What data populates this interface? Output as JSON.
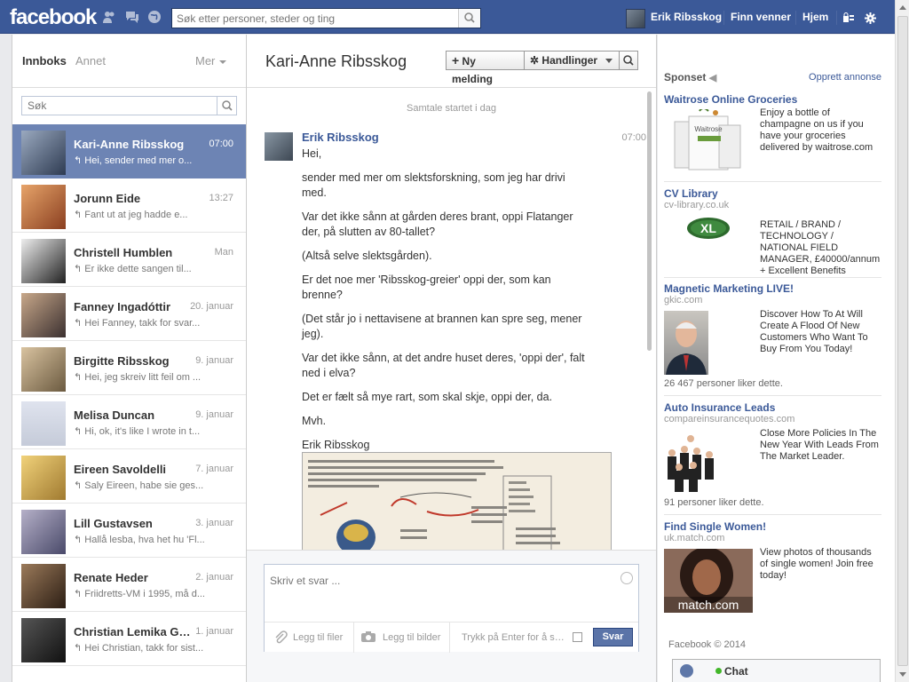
{
  "topbar": {
    "logo": "facebook",
    "search_placeholder": "Søk etter personer, steder og ting",
    "user_name": "Erik Ribsskog",
    "find_friends": "Finn venner",
    "home": "Hjem"
  },
  "left": {
    "tab_inbox": "Innboks",
    "tab_other": "Annet",
    "more": "Mer",
    "search_placeholder": "Søk",
    "threads": [
      {
        "name": "Kari-Anne Ribsskog",
        "date": "07:00",
        "snippet": "Hei, sender med mer o...",
        "selected": true
      },
      {
        "name": "Jorunn Eide",
        "date": "13:27",
        "snippet": "Fant ut at jeg hadde e..."
      },
      {
        "name": "Christell Humblen",
        "date": "Man",
        "snippet": "Er ikke dette sangen til..."
      },
      {
        "name": "Fanney Ingadóttir",
        "date": "20. januar",
        "snippet": "Hei Fanney, takk for svar..."
      },
      {
        "name": "Birgitte Ribsskog",
        "date": "9. januar",
        "snippet": "Hei, jeg skreiv litt feil om ..."
      },
      {
        "name": "Melisa Duncan",
        "date": "9. januar",
        "snippet": "Hi, ok, it's like I wrote in t..."
      },
      {
        "name": "Eireen Savoldelli",
        "date": "7. januar",
        "snippet": "Saly Eireen, habe sie ges..."
      },
      {
        "name": "Lill Gustavsen",
        "date": "3. januar",
        "snippet": "Hallå lesba, hva het hu 'Fl..."
      },
      {
        "name": "Renate Heder",
        "date": "2. januar",
        "snippet": "Friidretts-VM i 1995, må d..."
      },
      {
        "name": "Christian Lemika Gr...",
        "date": "1. januar",
        "snippet": "Hei Christian, takk for sist..."
      }
    ]
  },
  "conversation": {
    "title": "Kari-Anne Ribsskog",
    "new_message": "Ny melding",
    "actions": "Handlinger",
    "started": "Samtale startet i dag",
    "author": "Erik Ribsskog",
    "time": "07:00",
    "lines": [
      "Hei,",
      "sender med mer om slektsforskning, som jeg har drivi med.",
      "Var det ikke sånn at gården deres brant, oppi Flatanger der, på slutten av 80-tallet?",
      "(Altså selve slektsgården).",
      "Er det noe mer 'Ribsskog-greier' oppi der, som kan brenne?",
      "(Det står jo i nettavisene at brannen kan spre seg, mener jeg).",
      "Var det ikke sånn, at det andre huset deres, 'oppi der', falt ned i elva?",
      "Det er fælt så mye rart, som skal skje, oppi der, da.",
      "Mvh.",
      "Erik Ribsskog"
    ],
    "reply_placeholder": "Skriv et svar ...",
    "add_files": "Legg til filer",
    "add_photos": "Legg til bilder",
    "enter_to_send": "Trykk på Enter for å se...",
    "reply_button": "Svar"
  },
  "ads": {
    "sponsored": "Sponset",
    "create_ad": "Opprett annonse",
    "items": [
      {
        "title": "Waitrose Online Groceries",
        "url": "",
        "body": "Enjoy a bottle of champagne on us if you have your groceries delivered by waitrose.com",
        "likes": ""
      },
      {
        "title": "CV Library",
        "url": "cv-library.co.uk",
        "body": "RETAIL / BRAND / TECHNOLOGY / NATIONAL FIELD MANAGER, £40000/annum + Excellent Benefits",
        "likes": ""
      },
      {
        "title": "Magnetic Marketing LIVE!",
        "url": "gkic.com",
        "body": "Discover How To At Will Create A Flood Of New Customers Who Want To Buy From You Today!",
        "likes": "26 467 personer liker dette."
      },
      {
        "title": "Auto Insurance Leads",
        "url": "compareinsurancequotes.com",
        "body": "Close More Policies In The New Year With Leads From The Market Leader.",
        "likes": "91 personer liker dette."
      },
      {
        "title": "Find Single Women!",
        "url": "uk.match.com",
        "body": "View photos of thousands of single women! Join free today!",
        "likes": ""
      }
    ],
    "match_logo": "match.com",
    "xl_logo": "XL",
    "waitrose_logo": "Waitrose"
  },
  "footer": {
    "copyright": "Facebook © 2014"
  },
  "chat": {
    "label": "Chat"
  }
}
